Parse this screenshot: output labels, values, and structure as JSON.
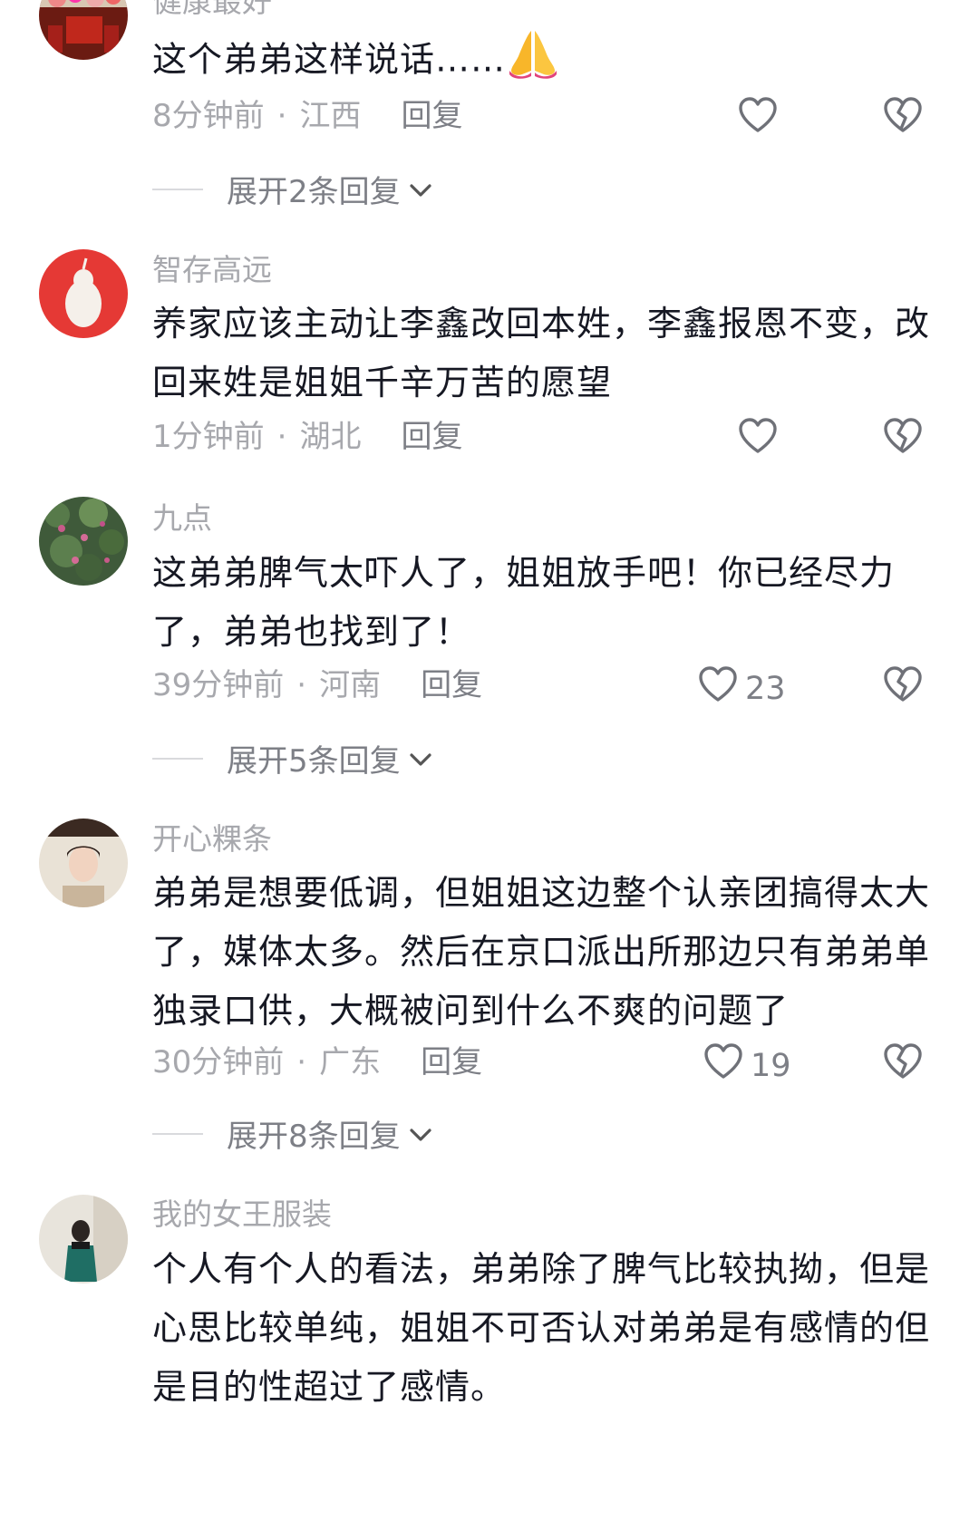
{
  "comments": [
    {
      "username": "健康最好",
      "text": "这个弟弟这样说话……",
      "emoji": "folded-hands",
      "time": "8分钟前",
      "location": "江西",
      "reply_label": "回复",
      "likes": "",
      "expand_label": "展开2条回复"
    },
    {
      "username": "智存高远",
      "text": "养家应该主动让李鑫改回本姓，李鑫报恩不变，改回来姓是姐姐千辛万苦的愿望",
      "time": "1分钟前",
      "location": "湖北",
      "reply_label": "回复",
      "likes": "",
      "expand_label": ""
    },
    {
      "username": "九点",
      "text": "这弟弟脾气太吓人了，姐姐放手吧！你已经尽力了，弟弟也找到了！",
      "time": "39分钟前",
      "location": "河南",
      "reply_label": "回复",
      "likes": "23",
      "expand_label": "展开5条回复"
    },
    {
      "username": "开心粿条",
      "text": "弟弟是想要低调，但姐姐这边整个认亲团搞得太大了，媒体太多。然后在京口派出所那边只有弟弟单独录口供，大概被问到什么不爽的问题了",
      "time": "30分钟前",
      "location": "广东",
      "reply_label": "回复",
      "likes": "19",
      "expand_label": "展开8条回复"
    },
    {
      "username": "我的女王服装",
      "text": "个人有个人的看法，弟弟除了脾气比较执拗，但是心思比较单纯，姐姐不可否认对弟弟是有感情的但是目的性超过了感情。"
    }
  ],
  "separator": "·",
  "icons": {
    "like": "heart-outline-icon",
    "dislike": "broken-heart-icon",
    "expand": "chevron-down-icon"
  }
}
